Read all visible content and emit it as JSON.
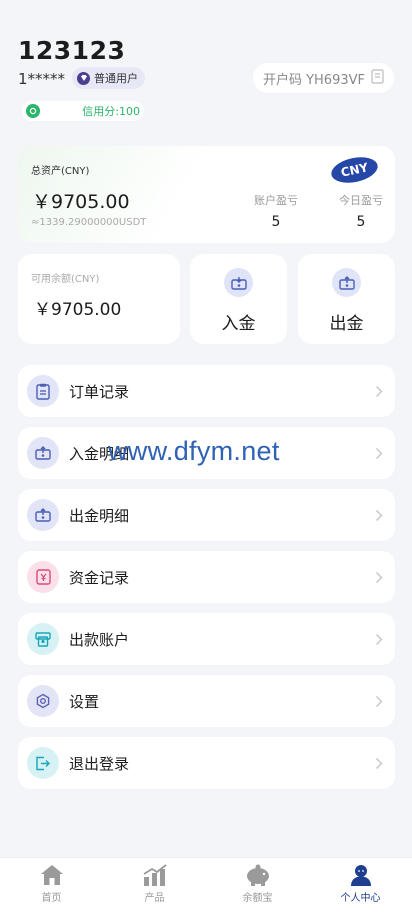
{
  "profile": {
    "username": "123123",
    "masked_phone": "1*****",
    "level_badge": "普通用户",
    "invite_code_label": "开户码 YH693VF",
    "credit_score": "信用分:100"
  },
  "assets": {
    "title": "总资产(CNY)",
    "amount": "￥9705.00",
    "usdt": "≈1339.29000000USDT",
    "currency_badge": "CNY",
    "account_pnl_label": "账户盈亏",
    "account_pnl_value": "5",
    "today_pnl_label": "今日盈亏",
    "today_pnl_value": "5"
  },
  "balance": {
    "label": "可用余额(CNY)",
    "amount": "￥9705.00"
  },
  "actions": {
    "deposit": "入金",
    "withdraw": "出金"
  },
  "menu": [
    {
      "label": "订单记录",
      "icon": "clipboard-icon",
      "color": "#4b5fb5",
      "bg": "#e1e5f7"
    },
    {
      "label": "入金明细",
      "icon": "deposit-icon",
      "color": "#4b5fb5",
      "bg": "#e1e5f7"
    },
    {
      "label": "出金明细",
      "icon": "withdraw-icon",
      "color": "#4b5fb5",
      "bg": "#e1e5f7"
    },
    {
      "label": "资金记录",
      "icon": "fund-record-icon",
      "color": "#d94a7a",
      "bg": "#fbe0ea"
    },
    {
      "label": "出款账户",
      "icon": "atm-card-icon",
      "color": "#18a6b8",
      "bg": "#d7f2f5"
    },
    {
      "label": "设置",
      "icon": "settings-icon",
      "color": "#5b63b8",
      "bg": "#e3e4f6"
    },
    {
      "label": "退出登录",
      "icon": "logout-icon",
      "color": "#18a6b8",
      "bg": "#d7f2f5"
    }
  ],
  "watermark": "www.dfym.net",
  "tabs": [
    {
      "label": "首页",
      "icon": "home-icon"
    },
    {
      "label": "产品",
      "icon": "chart-icon"
    },
    {
      "label": "余额宝",
      "icon": "piggy-bank-icon"
    },
    {
      "label": "个人中心",
      "icon": "user-icon",
      "active": true
    }
  ],
  "colors": {
    "brand": "#2547a8",
    "active_tab": "#1e3f8f",
    "credit_green": "#2bb56a",
    "background": "#f4f5f9"
  }
}
